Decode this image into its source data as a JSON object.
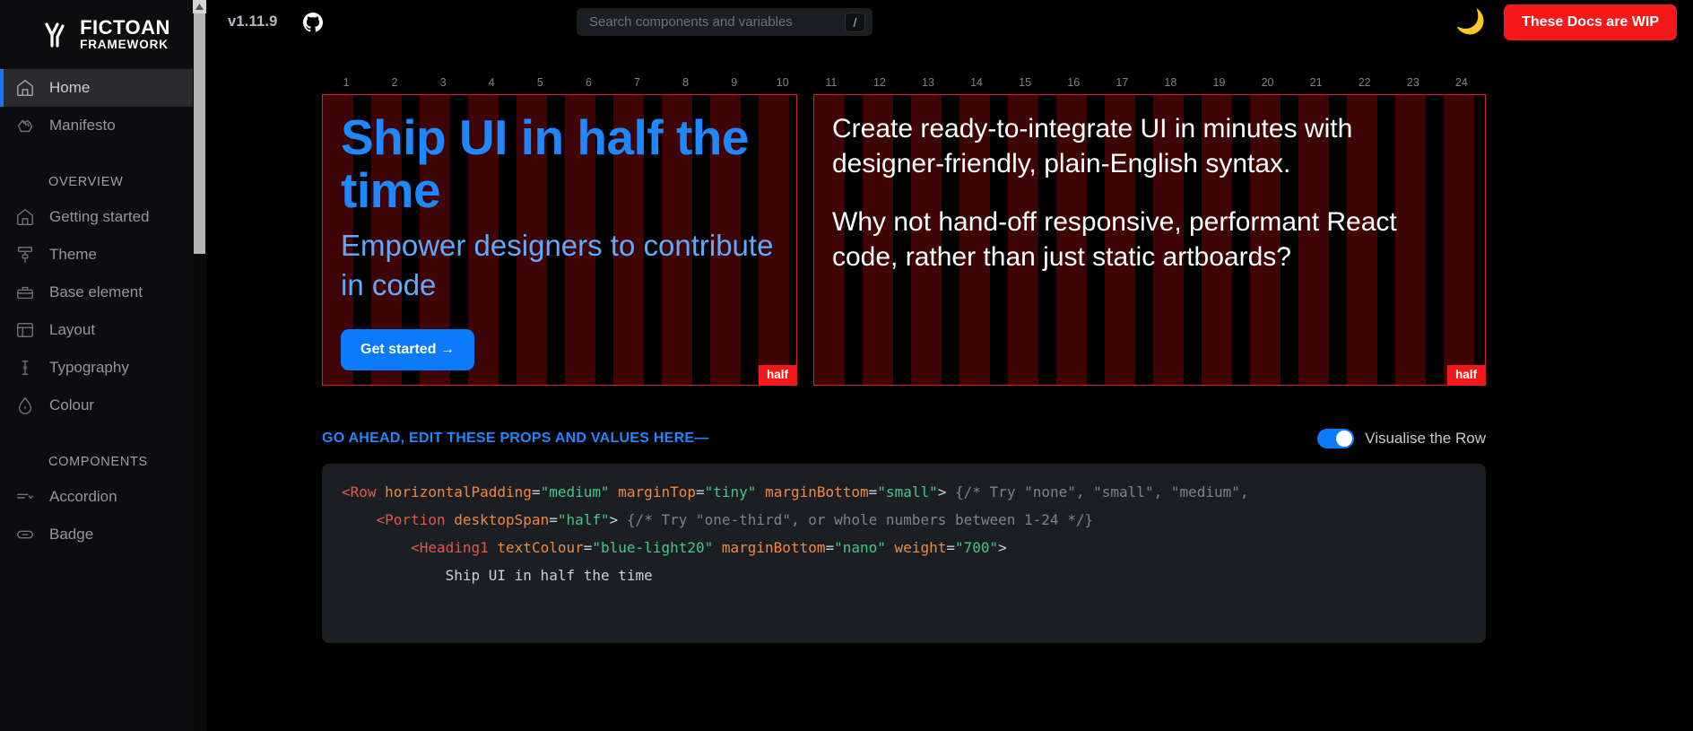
{
  "sidebar": {
    "logo": {
      "line1": "FICTOAN",
      "line2": "FRAMEWORK",
      "icon": "fictoan-logo-icon"
    },
    "primary_items": [
      {
        "label": "Home",
        "icon": "home-icon",
        "active": true
      },
      {
        "label": "Manifesto",
        "icon": "fist-icon",
        "active": false
      }
    ],
    "sections": [
      {
        "title": "OVERVIEW",
        "items": [
          {
            "label": "Getting started",
            "icon": "home-icon"
          },
          {
            "label": "Theme",
            "icon": "paint-roller-icon"
          },
          {
            "label": "Base element",
            "icon": "toolbox-icon"
          },
          {
            "label": "Layout",
            "icon": "layout-icon"
          },
          {
            "label": "Typography",
            "icon": "text-cursor-icon"
          },
          {
            "label": "Colour",
            "icon": "droplet-icon"
          }
        ]
      },
      {
        "title": "COMPONENTS",
        "items": [
          {
            "label": "Accordion",
            "icon": "accordion-icon"
          },
          {
            "label": "Badge",
            "icon": "badge-icon"
          }
        ]
      }
    ]
  },
  "topbar": {
    "version": "v1.11.9",
    "github_icon": "github-icon",
    "search": {
      "placeholder": "Search components and variables",
      "value": "",
      "shortcut": "/"
    },
    "theme_toggle_icon": "moon-sparkles-icon",
    "theme_toggle_glyph": "🌙",
    "wip_button_label": "These Docs are WIP"
  },
  "ruler": {
    "columns": [
      "1",
      "2",
      "3",
      "4",
      "5",
      "6",
      "7",
      "8",
      "9",
      "10",
      "11",
      "12",
      "13",
      "14",
      "15",
      "16",
      "17",
      "18",
      "19",
      "20",
      "21",
      "22",
      "23",
      "24"
    ]
  },
  "hero": {
    "left": {
      "title": "Ship UI in half the time",
      "subtitle": "Empower designers to contribute in code",
      "cta_label": "Get started →",
      "span_badge": "half"
    },
    "right": {
      "paragraph1": "Create ready-to-integrate UI in minutes with designer-friendly, plain-English syntax.",
      "paragraph2": "Why not hand-off responsive, performant React code, rather than just static artboards?",
      "span_badge": "half"
    }
  },
  "props_section": {
    "title": "GO AHEAD, EDIT THESE PROPS AND VALUES HERE—",
    "visualise_label": "Visualise the Row",
    "visualise_on": true
  },
  "code": {
    "line1": {
      "tag_open": "<Row",
      "attr1": "horizontalPadding",
      "val1": "\"medium\"",
      "attr2": "marginTop",
      "val2": "\"tiny\"",
      "attr3": "marginBottom",
      "val3": "\"small\"",
      "close": ">",
      "comment": "{/* Try \"none\", \"small\", \"medium\","
    },
    "line2": {
      "tag_open": "<Portion",
      "attr1": "desktopSpan",
      "val1": "\"half\"",
      "close": ">",
      "comment": "{/* Try \"one-third\", or whole numbers between 1-24 */}"
    },
    "line3": {
      "tag_open": "<Heading1",
      "attr1": "textColour",
      "val1": "\"blue-light20\"",
      "attr2": "marginBottom",
      "val2": "\"nano\"",
      "attr3": "weight",
      "val3": "\"700\"",
      "close": ">"
    },
    "line4": {
      "text": "Ship UI in half the time"
    }
  },
  "colors": {
    "accent_blue": "#1f87ff",
    "cta_blue": "#0b7bfb",
    "wip_red": "#f41818",
    "grid_red": "#e02020",
    "sidebar_bg": "#0d0d0f",
    "code_bg": "#1b1f23"
  }
}
